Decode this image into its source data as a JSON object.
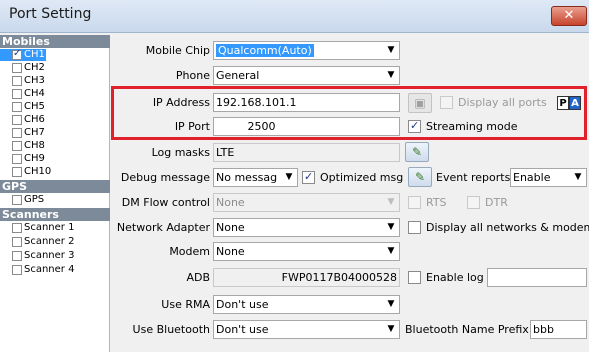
{
  "window": {
    "title": "Port Setting",
    "close_glyph": "✕"
  },
  "sidebar": {
    "groups": [
      {
        "label": "Mobiles",
        "items": [
          "CH1",
          "CH2",
          "CH3",
          "CH4",
          "CH5",
          "CH6",
          "CH7",
          "CH8",
          "CH9",
          "CH10"
        ]
      },
      {
        "label": "GPS",
        "items": [
          "GPS"
        ]
      },
      {
        "label": "Scanners",
        "items": [
          "Scanner 1",
          "Scanner 2",
          "Scanner 3",
          "Scanner 4"
        ]
      }
    ],
    "selected": "CH1",
    "checked": [
      "CH1"
    ]
  },
  "form": {
    "mobile_chip": {
      "label": "Mobile Chip",
      "value": "Qualcomm(Auto)"
    },
    "phone": {
      "label": "Phone",
      "value": "General"
    },
    "ip_address": {
      "label": "IP Address",
      "value": "192.168.101.1"
    },
    "ip_port": {
      "label": "IP Port",
      "value": "2500"
    },
    "display_all_ports": {
      "label": "Display all ports",
      "checked": false,
      "badge_p": "P",
      "badge_a": "A"
    },
    "streaming_mode": {
      "label": "Streaming mode",
      "checked": true
    },
    "log_masks": {
      "label": "Log masks",
      "value": "LTE"
    },
    "debug_message": {
      "label": "Debug message",
      "value": "No messag"
    },
    "optimized_msg": {
      "label": "Optimized msg",
      "checked": true
    },
    "event_reports": {
      "label": "Event reports",
      "value": "Enable"
    },
    "dm_flow_control": {
      "label": "DM Flow control",
      "value": "None"
    },
    "rts": {
      "label": "RTS",
      "checked": false
    },
    "dtr": {
      "label": "DTR",
      "checked": false
    },
    "network_adapter": {
      "label": "Network Adapter",
      "value": "None"
    },
    "display_all_networks": {
      "label": "Display all networks & modems",
      "checked": false
    },
    "modem": {
      "label": "Modem",
      "value": "None"
    },
    "adb": {
      "label": "ADB",
      "value": "FWP0117B04000528"
    },
    "enable_log": {
      "label": "Enable log",
      "checked": false,
      "value": ""
    },
    "use_rma": {
      "label": "Use RMA",
      "value": "Don't use"
    },
    "use_bluetooth": {
      "label": "Use Bluetooth",
      "value": "Don't use"
    },
    "bluetooth_name_prefix": {
      "label": "Bluetooth Name Prefix",
      "value": "bbb"
    }
  },
  "icons": {
    "log_masks_button": "edit-icon",
    "event_reports_button": "edit-icon",
    "ip_ports_button": "port-icon"
  },
  "colors": {
    "selection": "#3399ff",
    "highlight_box": "#e0202a",
    "group_header": "#7d8a99"
  }
}
